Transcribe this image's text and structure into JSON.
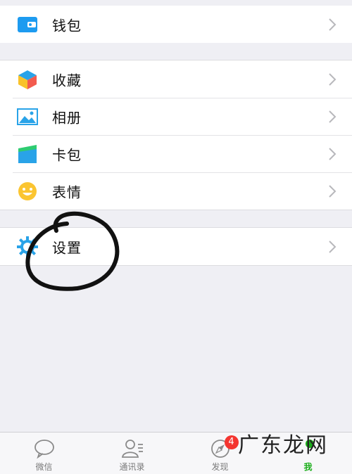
{
  "menu_groups": [
    {
      "items": [
        {
          "label": "钱包",
          "icon": "wallet-icon"
        }
      ]
    },
    {
      "items": [
        {
          "label": "收藏",
          "icon": "favorites-cube-icon"
        },
        {
          "label": "相册",
          "icon": "album-icon"
        },
        {
          "label": "卡包",
          "icon": "card-pack-icon"
        },
        {
          "label": "表情",
          "icon": "smiley-icon"
        }
      ]
    },
    {
      "items": [
        {
          "label": "设置",
          "icon": "settings-gear-icon"
        }
      ]
    }
  ],
  "tabbar": {
    "tabs": [
      {
        "label": "微信",
        "icon": "chat-bubble-icon"
      },
      {
        "label": "通讯录",
        "icon": "contacts-icon"
      },
      {
        "label": "发现",
        "icon": "compass-icon",
        "badge": "4"
      },
      {
        "label": "我",
        "icon": "me-icon",
        "active": true
      }
    ]
  },
  "watermark": "广东龙网",
  "colors": {
    "accent": "#1aad19",
    "badge": "#f43530",
    "background": "#efeff4"
  }
}
